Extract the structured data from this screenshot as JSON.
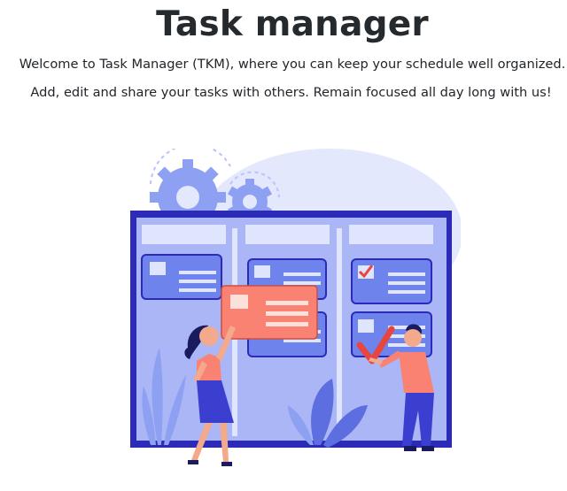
{
  "page": {
    "title": "Task manager",
    "intro_line_1": "Welcome to Task Manager (TKM), where you can keep your schedule well organized.",
    "intro_line_2": "Add, edit and share your tasks with others. Remain focused all day long with us!"
  },
  "illustration": {
    "subject": "kanban task board with two people moving cards",
    "colors": {
      "board_frame": "#2b2bb8",
      "board_fill": "#aab6f5",
      "card_blue": "#6e84ec",
      "card_coral": "#f98272",
      "backdrop": "#e3e8fd",
      "gear": "#8ea0f2",
      "check": "#e8463c",
      "skin": "#f3a98c",
      "hair": "#1a1a5e",
      "pants": "#3b3fd0",
      "plant": "#5d6ee0"
    }
  }
}
